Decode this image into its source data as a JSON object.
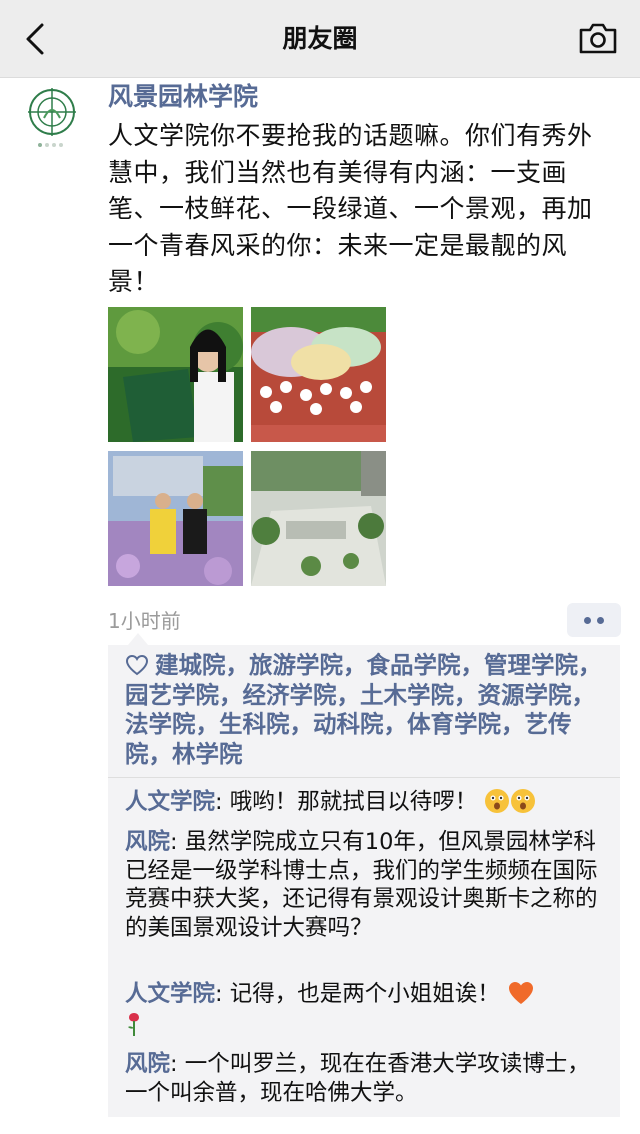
{
  "navbar": {
    "title": "朋友圈",
    "back_icon": "chevron-left-icon",
    "camera_icon": "camera-icon"
  },
  "post": {
    "author": "风景园林学院",
    "text": "人文学院你不要抢我的话题嘛。你们有秀外慧中，我们当然也有美得有内涵：一支画笔、一枝鲜花、一段绿道、一个景观，再加一个青春风采的你：未来一定是最靓的风景！",
    "images": [
      "photo-girl-with-drawing-board",
      "photo-colorful-parade",
      "photo-two-women-in-lavender",
      "photo-landscape-plaza"
    ],
    "time": "1小时前"
  },
  "likes": {
    "icon": "heart-outline-icon",
    "text": "建城院，旅游学院，食品学院，管理学院，园艺学院，经济学院，土木学院，资源学院，法学院，生科院，动科院，体育学院，艺传院，林学院"
  },
  "comments": [
    {
      "name": "人文学院",
      "text": ": 哦哟！那就拭目以待啰！",
      "emoji": [
        "surprised-face-icon",
        "surprised-face-icon"
      ]
    },
    {
      "name": "风院",
      "text": ": 虽然学院成立只有10年，但风景园林学科已经是一级学科博士点，我们的学生频频在国际竞赛中获大奖，还记得有景观设计奥斯卡之称的的美国景观设计大赛吗？",
      "emoji": []
    },
    {
      "name": "人文学院",
      "text": ": 记得，也是两个小姐姐诶！",
      "emoji": [
        "heart-icon",
        "rose-icon"
      ]
    },
    {
      "name": "风院",
      "text": ": 一个叫罗兰，现在在香港大学攻读博士，一个叫余普，现在哈佛大学。",
      "emoji": []
    }
  ],
  "colors": {
    "link": "#576b95",
    "navbar_bg": "#ededed",
    "comment_bg": "#f3f3f5",
    "time": "#9b9b9b"
  }
}
